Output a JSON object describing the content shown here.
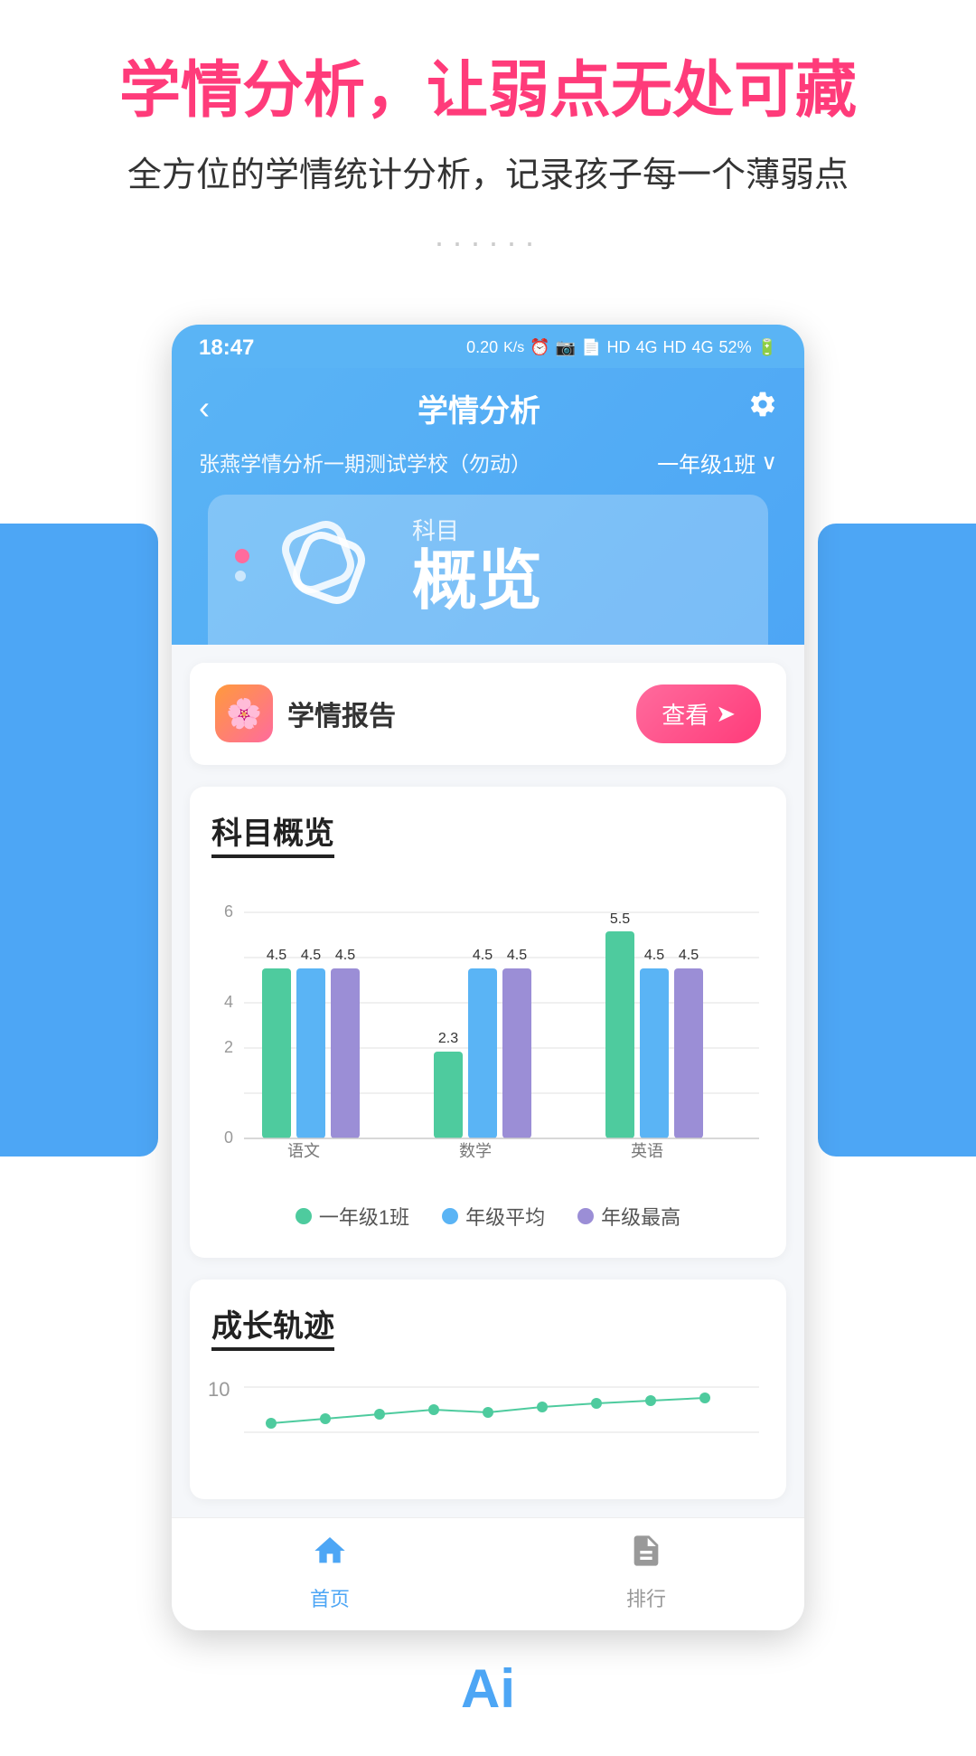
{
  "header": {
    "title": "学情分析，让弱点无处可藏",
    "subtitle": "全方位的学情统计分析，记录孩子每一个薄弱点",
    "dots": "······"
  },
  "statusBar": {
    "time": "18:47",
    "icons": "0.20 K/s ⏰ WiFi HD 4G HD 4G 52%"
  },
  "appHeader": {
    "back": "‹",
    "title": "学情分析",
    "gear": "⚙",
    "schoolName": "张燕学情分析一期测试学校（勿动）",
    "classSelector": "一年级1班",
    "chevron": "∨"
  },
  "subjectCard": {
    "label": "科目",
    "value": "概览"
  },
  "reportCard": {
    "icon": "🌸",
    "title": "学情报告",
    "btnLabel": "查看",
    "btnArrow": "➤"
  },
  "subjectOverview": {
    "sectionTitle": "科目概览",
    "yMax": "6",
    "yMid": "4",
    "yLow": "2",
    "yMin": "0",
    "subjects": [
      "语文",
      "数学",
      "英语"
    ],
    "bars": [
      {
        "subject": "语文",
        "class1": 4.5,
        "avg": 4.5,
        "max": 4.5,
        "labels": [
          "4.5",
          "4.5",
          "4.5"
        ]
      },
      {
        "subject": "数学",
        "class1": 2.3,
        "avg": 4.5,
        "max": 4.5,
        "labels": [
          "2.3",
          "4.5",
          "4.5"
        ]
      },
      {
        "subject": "英语",
        "class1": 5.5,
        "avg": 4.5,
        "max": 4.5,
        "labels": [
          "5.5",
          "4.5",
          "4.5"
        ]
      }
    ],
    "legend": [
      {
        "label": "一年级1班",
        "color": "#4ecb9e"
      },
      {
        "label": "年级平均",
        "color": "#5ab4f5"
      },
      {
        "label": "年级最高",
        "color": "#9b8ed6"
      }
    ]
  },
  "growthSection": {
    "sectionTitle": "成长轨迹",
    "yLabel": "10"
  },
  "bottomNav": {
    "items": [
      {
        "label": "首页",
        "icon": "🏠",
        "active": true
      },
      {
        "label": "排行",
        "icon": "📋",
        "active": false
      }
    ]
  }
}
